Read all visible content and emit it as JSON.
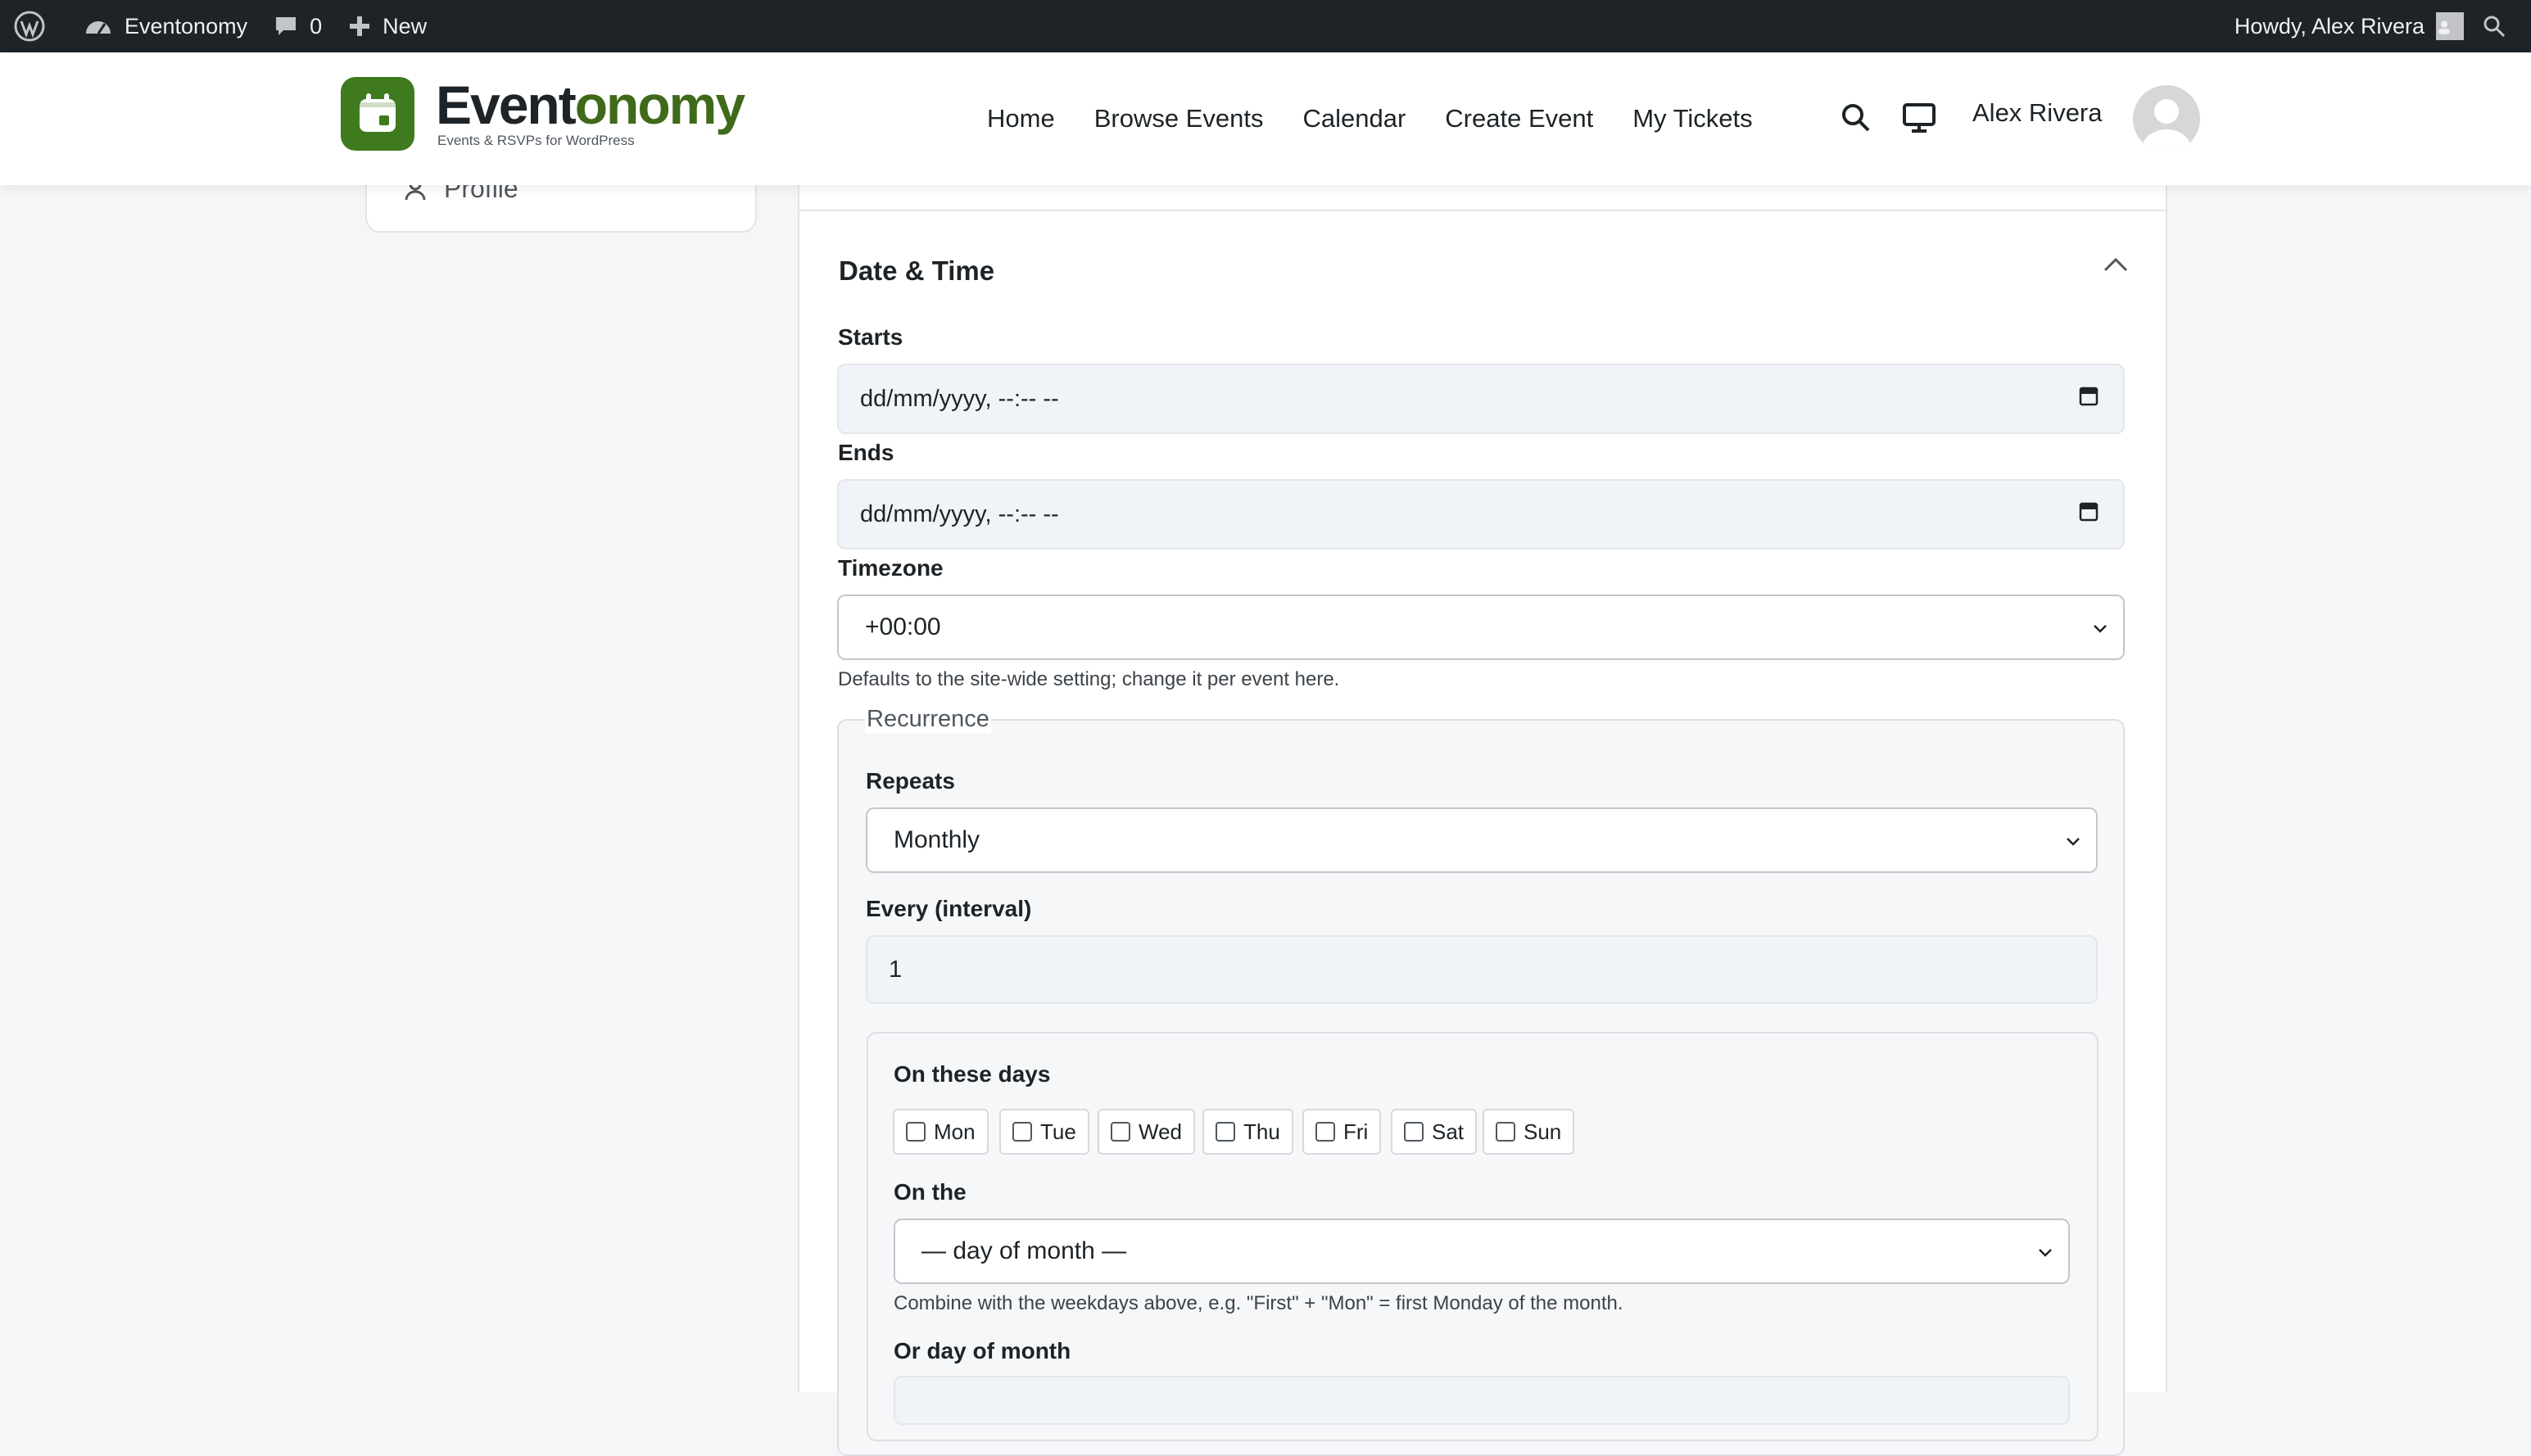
{
  "admin_bar": {
    "site_name": "Eventonomy",
    "comments_count": "0",
    "new_label": "New",
    "howdy": "Howdy, Alex Rivera"
  },
  "header": {
    "logo_word_a": "Event",
    "logo_word_b": "onomy",
    "tagline": "Events & RSVPs for WordPress",
    "nav": [
      "Home",
      "Browse Events",
      "Calendar",
      "Create Event",
      "My Tickets"
    ],
    "user_name": "Alex Rivera"
  },
  "sidebar": {
    "profile_label": "Profile"
  },
  "section": {
    "title": "Date & Time",
    "starts_label": "Starts",
    "starts_value": "dd/mm/yyyy, --:-- --",
    "ends_label": "Ends",
    "ends_value": "dd/mm/yyyy, --:-- --",
    "timezone_label": "Timezone",
    "timezone_value": "+00:00",
    "timezone_help": "Defaults to the site-wide setting; change it per event here."
  },
  "recurrence": {
    "legend": "Recurrence",
    "repeats_label": "Repeats",
    "repeats_value": "Monthly",
    "interval_label": "Every (interval)",
    "interval_value": "1",
    "days_label": "On these days",
    "days": [
      "Mon",
      "Tue",
      "Wed",
      "Thu",
      "Fri",
      "Sat",
      "Sun"
    ],
    "on_the_label": "On the",
    "on_the_value": "— day of month —",
    "on_the_help": "Combine with the weekdays above, e.g. \"First\" + \"Mon\" = first Monday of the month.",
    "day_of_month_label": "Or day of month"
  }
}
